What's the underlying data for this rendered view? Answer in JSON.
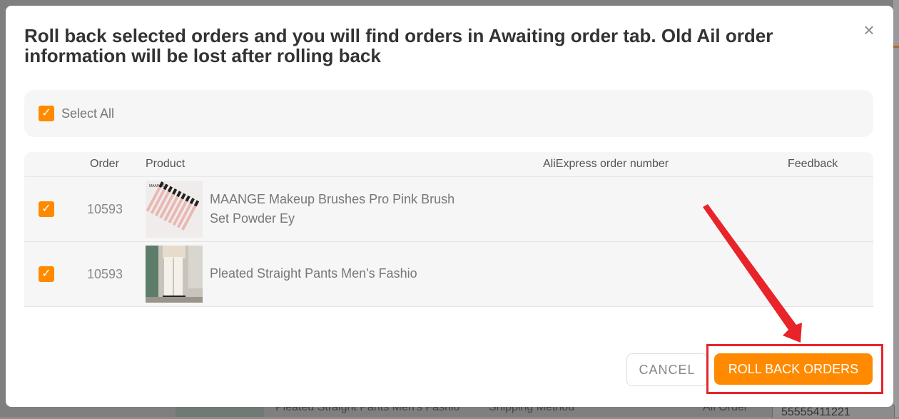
{
  "background": {
    "product_name": "Pleated Straight Pants Men's Fashio",
    "shipping_label": "Shipping Method",
    "order_label": "Ali Order",
    "input_value": "55555411221"
  },
  "dialog": {
    "title": "Roll back selected orders and you will find orders in Awaiting order tab. Old Ail order information will be lost after rolling back",
    "close_icon": "×",
    "select_all_label": "Select All",
    "columns": {
      "order": "Order",
      "product": "Product",
      "aliexpress_order_number": "AliExpress order number",
      "feedback": "Feedback"
    },
    "rows": [
      {
        "order": "10593",
        "product_line1": "MAANGE Makeup Brushes Pro Pink Brush",
        "product_line2": "Set Powder Ey",
        "aliexpress_order_number": "",
        "feedback": "",
        "checked": true,
        "thumb_brand": "MAANGE"
      },
      {
        "order": "10593",
        "product_line1": "Pleated Straight Pants Men's Fashio",
        "product_line2": "",
        "aliexpress_order_number": "",
        "feedback": "",
        "checked": true
      }
    ],
    "cancel_label": "CANCEL",
    "rollback_label": "ROLL BACK ORDERS"
  },
  "colors": {
    "accent": "#ff8a00",
    "annotation": "#e8242a"
  }
}
